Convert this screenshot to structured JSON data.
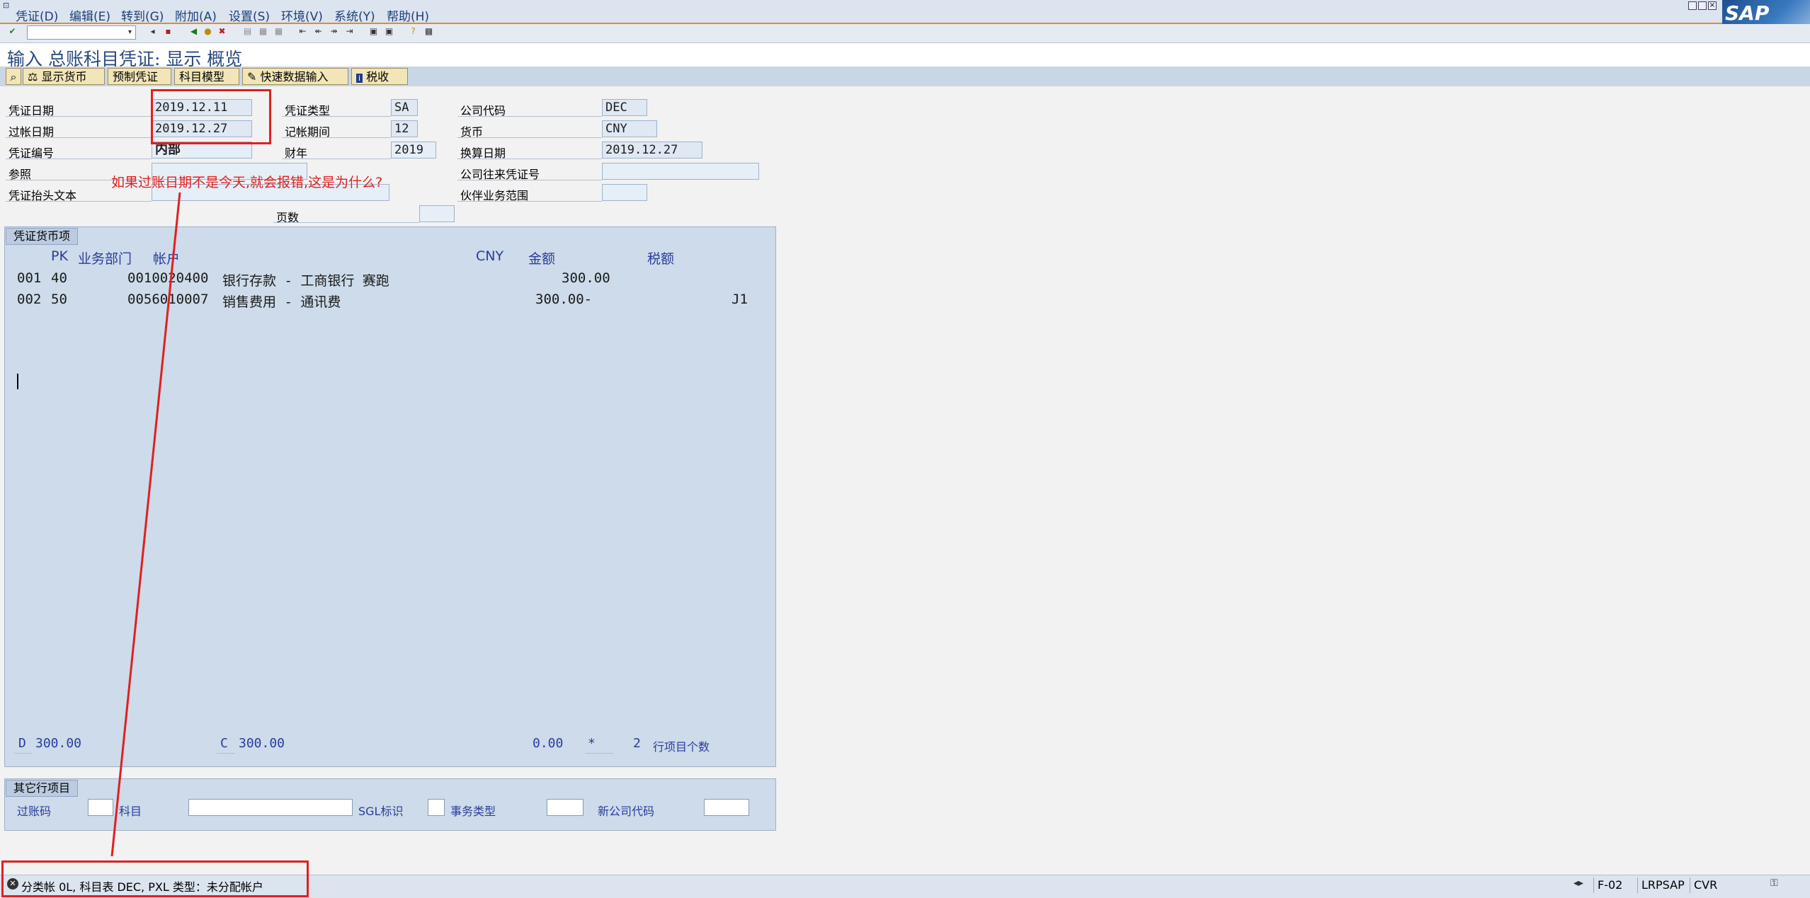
{
  "menu": {
    "items": [
      "凭证(D)",
      "编辑(E)",
      "转到(G)",
      "附加(A)",
      "设置(S)",
      "环境(V)",
      "系统(Y)",
      "帮助(H)"
    ]
  },
  "logo": {
    "text": "SAP"
  },
  "title": "输入 总账科目凭证: 显示 概览",
  "app_toolbar": {
    "buttons": [
      "显示货币",
      "预制凭证",
      "科目模型",
      "快速数据输入",
      "税收"
    ]
  },
  "header": {
    "doc_date_label": "凭证日期",
    "doc_date": "2019.12.11",
    "posting_date_label": "过帐日期",
    "posting_date": "2019.12.27",
    "doc_number_label": "凭证编号",
    "doc_number": "内部",
    "reference_label": "参照",
    "header_text_label": "凭证抬头文本",
    "doc_type_label": "凭证类型",
    "doc_type": "SA",
    "period_label": "记帐期间",
    "period": "12",
    "fiscal_year_label": "财年",
    "fiscal_year": "2019",
    "page_label": "页数",
    "company_code_label": "公司代码",
    "company_code": "DEC",
    "currency_label": "货币",
    "currency": "CNY",
    "translation_date_label": "换算日期",
    "translation_date": "2019.12.27",
    "intercompany_label": "公司往来凭证号",
    "partner_area_label": "伙伴业务范围"
  },
  "annotation": "如果过账日期不是今天,就会报错,这是为什么?",
  "items_panel": {
    "tab": "凭证货币项",
    "col_pk": "PK",
    "col_bus_area": "业务部门",
    "col_account": "帐户",
    "col_currency": "CNY",
    "col_amount": "金额",
    "col_tax": "税额",
    "rows": [
      {
        "no": "001",
        "pk": "40",
        "account": "0010020400",
        "text": "银行存款 - 工商银行 赛跑",
        "amount": "300.00",
        "tax": ""
      },
      {
        "no": "002",
        "pk": "50",
        "account": "0056010007",
        "text": "销售费用 - 通讯费",
        "amount": "300.00-",
        "tax": "J1"
      }
    ],
    "footer": {
      "d_label": "D",
      "d_value": "300.00",
      "c_label": "C",
      "c_value": "300.00",
      "diff": "0.00",
      "star": "*",
      "count": "2",
      "count_label": "行项目个数"
    }
  },
  "other_items": {
    "tab": "其它行项目",
    "posting_key_label": "过账码",
    "account_label": "科目",
    "sgl_label": "SGL标识",
    "trans_type_label": "事务类型",
    "new_company_label": "新公司代码"
  },
  "status": {
    "message": "分类帐 0L, 科目表 DEC, PXL 类型：未分配帐户",
    "transaction": "F-02",
    "server": "LRPSAP",
    "client": "CVR"
  }
}
